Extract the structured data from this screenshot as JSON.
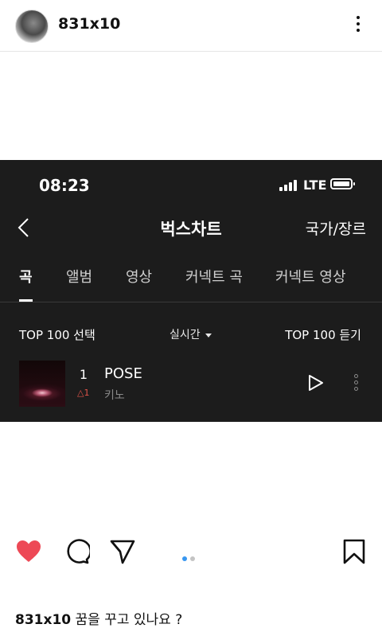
{
  "post": {
    "username": "831x10",
    "caption_user": "831x10",
    "caption_text": "꿈을 꾸고 있나요 ?"
  },
  "screenshot": {
    "status_bar": {
      "time": "08:23",
      "network": "LTE"
    },
    "header": {
      "title": "벅스차트",
      "right_link": "국가/장르"
    },
    "tabs": [
      {
        "label": "곡",
        "active": true
      },
      {
        "label": "앨범",
        "active": false
      },
      {
        "label": "영상",
        "active": false
      },
      {
        "label": "커넥트 곡",
        "active": false
      },
      {
        "label": "커넥트 영상",
        "active": false
      }
    ],
    "options": {
      "select_label": "TOP 100 선택",
      "period_label": "실시간",
      "listen_label": "TOP 100 듣기"
    },
    "track": {
      "rank": "1",
      "rank_change": "1",
      "title": "POSE",
      "artist": "키노"
    }
  },
  "colors": {
    "like": "#ed4956",
    "dot_active": "#3897f0",
    "dot_inactive": "#c4c4c4",
    "rank_up": "#e0534a"
  },
  "icons": [
    "more-vert-icon",
    "back-chevron-icon",
    "signal-icon",
    "battery-icon",
    "play-icon",
    "heart-icon",
    "comment-icon",
    "share-icon",
    "bookmark-icon"
  ]
}
